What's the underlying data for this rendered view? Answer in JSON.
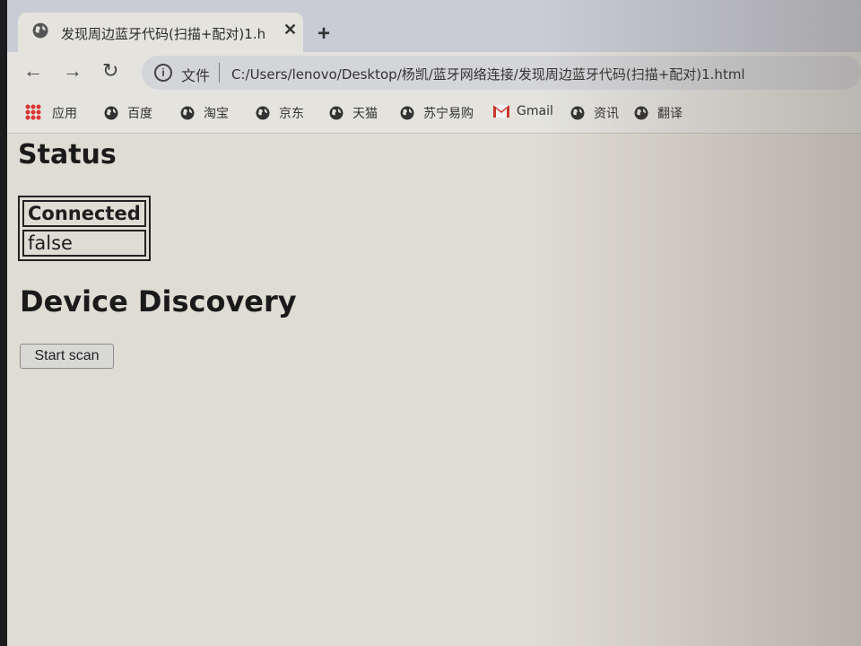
{
  "browser": {
    "tab": {
      "title": "发现周边蓝牙代码(扫描+配对)1.h",
      "close": "✕"
    },
    "new_tab": "+",
    "nav": {
      "back": "←",
      "forward": "→",
      "reload": "↻"
    },
    "omnibox": {
      "info": "i",
      "scheme_label": "文件",
      "url": "C:/Users/lenovo/Desktop/杨凯/蓝牙网络连接/发现周边蓝牙代码(扫描+配对)1.html"
    },
    "bookmarks": [
      {
        "label": "应用",
        "icon": "apps-grid-icon"
      },
      {
        "label": "百度",
        "icon": "globe-icon"
      },
      {
        "label": "淘宝",
        "icon": "globe-icon"
      },
      {
        "label": "京东",
        "icon": "globe-icon"
      },
      {
        "label": "天猫",
        "icon": "globe-icon"
      },
      {
        "label": "苏宁易购",
        "icon": "globe-icon"
      },
      {
        "label": "Gmail",
        "icon": "gmail-icon"
      },
      {
        "label": "资讯",
        "icon": "globe-icon"
      },
      {
        "label": "翻译",
        "icon": "globe-icon"
      }
    ]
  },
  "page": {
    "status_heading": "Status",
    "status_table": {
      "header": "Connected",
      "value": "false"
    },
    "discovery_heading": "Device Discovery",
    "scan_button": "Start scan"
  }
}
